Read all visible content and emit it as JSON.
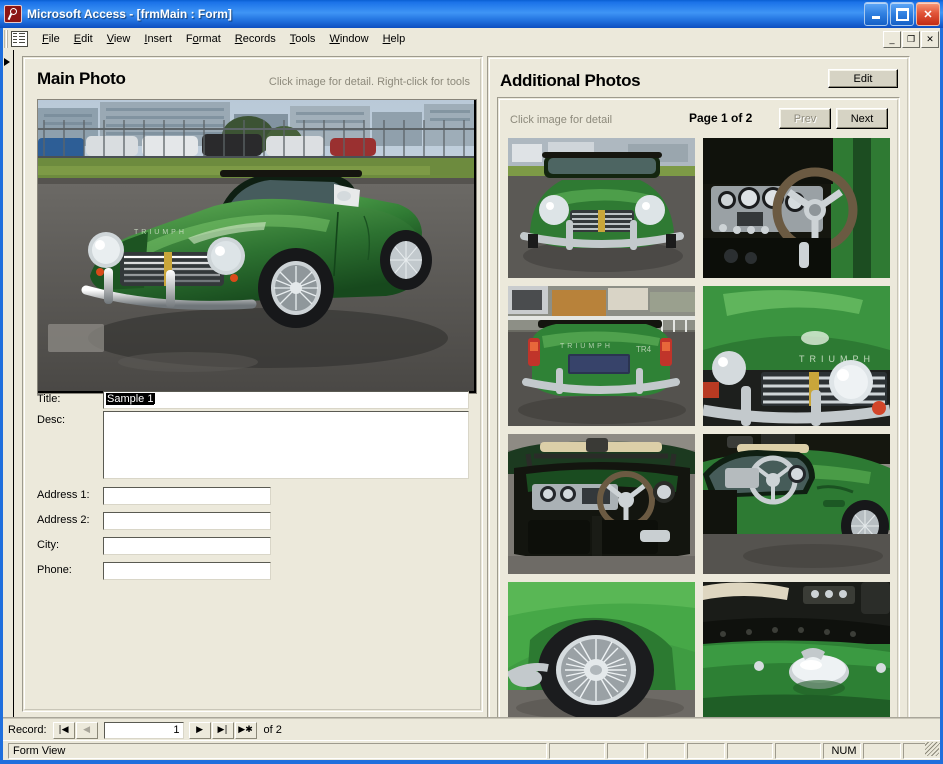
{
  "window": {
    "title": "Microsoft Access - [frmMain : Form]",
    "app_icon": "access-key-icon",
    "minimize_label": "",
    "maximize_label": "",
    "close_label": "✕",
    "mdi_minimize": "_",
    "mdi_restore": "❐",
    "mdi_close": "✕"
  },
  "menu": {
    "items": [
      {
        "pre": "",
        "accel": "F",
        "post": "ile"
      },
      {
        "pre": "",
        "accel": "E",
        "post": "dit"
      },
      {
        "pre": "",
        "accel": "V",
        "post": "iew"
      },
      {
        "pre": "",
        "accel": "I",
        "post": "nsert"
      },
      {
        "pre": "F",
        "accel": "o",
        "post": "rmat"
      },
      {
        "pre": "",
        "accel": "R",
        "post": "ecords"
      },
      {
        "pre": "",
        "accel": "T",
        "post": "ools"
      },
      {
        "pre": "",
        "accel": "W",
        "post": "indow"
      },
      {
        "pre": "",
        "accel": "H",
        "post": "elp"
      }
    ]
  },
  "main_photo": {
    "heading": "Main Photo",
    "hint": "Click image for detail.  Right-click for tools",
    "image_alt": "green-classic-convertible-car"
  },
  "fields": [
    {
      "label": "Title:",
      "value": "Sample 1",
      "selected": true
    },
    {
      "label": "Desc:",
      "value": "",
      "selected": false
    },
    {
      "label": "Address 1:",
      "value": "",
      "selected": false
    },
    {
      "label": "Address 2:",
      "value": "",
      "selected": false
    },
    {
      "label": "City:",
      "value": "",
      "selected": false
    },
    {
      "label": "Phone:",
      "value": "",
      "selected": false
    }
  ],
  "additional_photos": {
    "heading": "Additional Photos",
    "edit_label": "Edit",
    "hint": "Click image for detail",
    "page_label": "Page 1 of 2",
    "prev_label": "Prev",
    "next_label": "Next",
    "prev_disabled": true,
    "next_disabled": false,
    "thumbnails": [
      {
        "alt": "car-front-view"
      },
      {
        "alt": "car-dashboard-steering-wheel"
      },
      {
        "alt": "car-rear-view"
      },
      {
        "alt": "car-front-grille-closeup"
      },
      {
        "alt": "car-interior-cockpit"
      },
      {
        "alt": "car-side-view-cockpit"
      },
      {
        "alt": "car-wire-wheel-closeup"
      },
      {
        "alt": "car-fuel-cap-closeup"
      }
    ]
  },
  "navigator": {
    "record_label": "Record:",
    "first_glyph": "|◀",
    "prev_glyph": "◀",
    "current": "1",
    "next_glyph": "▶",
    "last_glyph": "▶|",
    "new_glyph": "▶✱",
    "of_label": "of  2",
    "prev_disabled": true
  },
  "status_bar": {
    "view_label": "Form View",
    "indicators": [
      "",
      "",
      "",
      "",
      "",
      "",
      "NUM",
      "",
      ""
    ]
  },
  "colors": {
    "form_background": "#ece9db",
    "title_bar": "#1f6fdd",
    "car_green": "#2d6b32"
  }
}
